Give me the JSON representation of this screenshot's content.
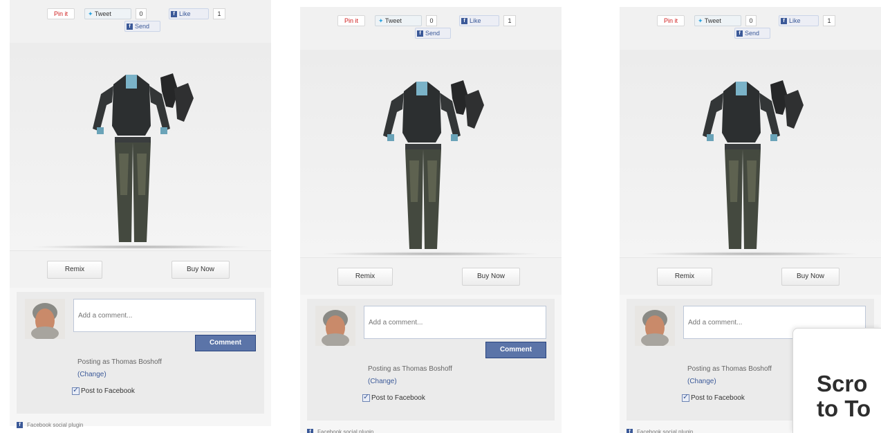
{
  "share": {
    "pin_label": "Pin it",
    "tweet_label": "Tweet",
    "tweet_count": "0",
    "like_label": "Like",
    "like_count": "1",
    "send_label": "Send"
  },
  "actions": {
    "remix_label": "Remix",
    "buy_label": "Buy Now"
  },
  "comments": {
    "placeholder": "Add a comment...",
    "submit_label": "Comment",
    "posting_as": "Posting as Thomas Boshoff",
    "change_label": "(Change)",
    "post_to_facebook_label": "Post to Facebook",
    "post_to_facebook_checked": true
  },
  "footer": {
    "plugin_label": "Facebook social plugin"
  },
  "popup": {
    "text_line1": "Scro",
    "text_line2": "to To"
  },
  "colors": {
    "facebook_blue": "#3b5998",
    "comment_button": "#5b74a8",
    "pin_red": "#d02020",
    "twitter_blue": "#2aa3e0"
  }
}
